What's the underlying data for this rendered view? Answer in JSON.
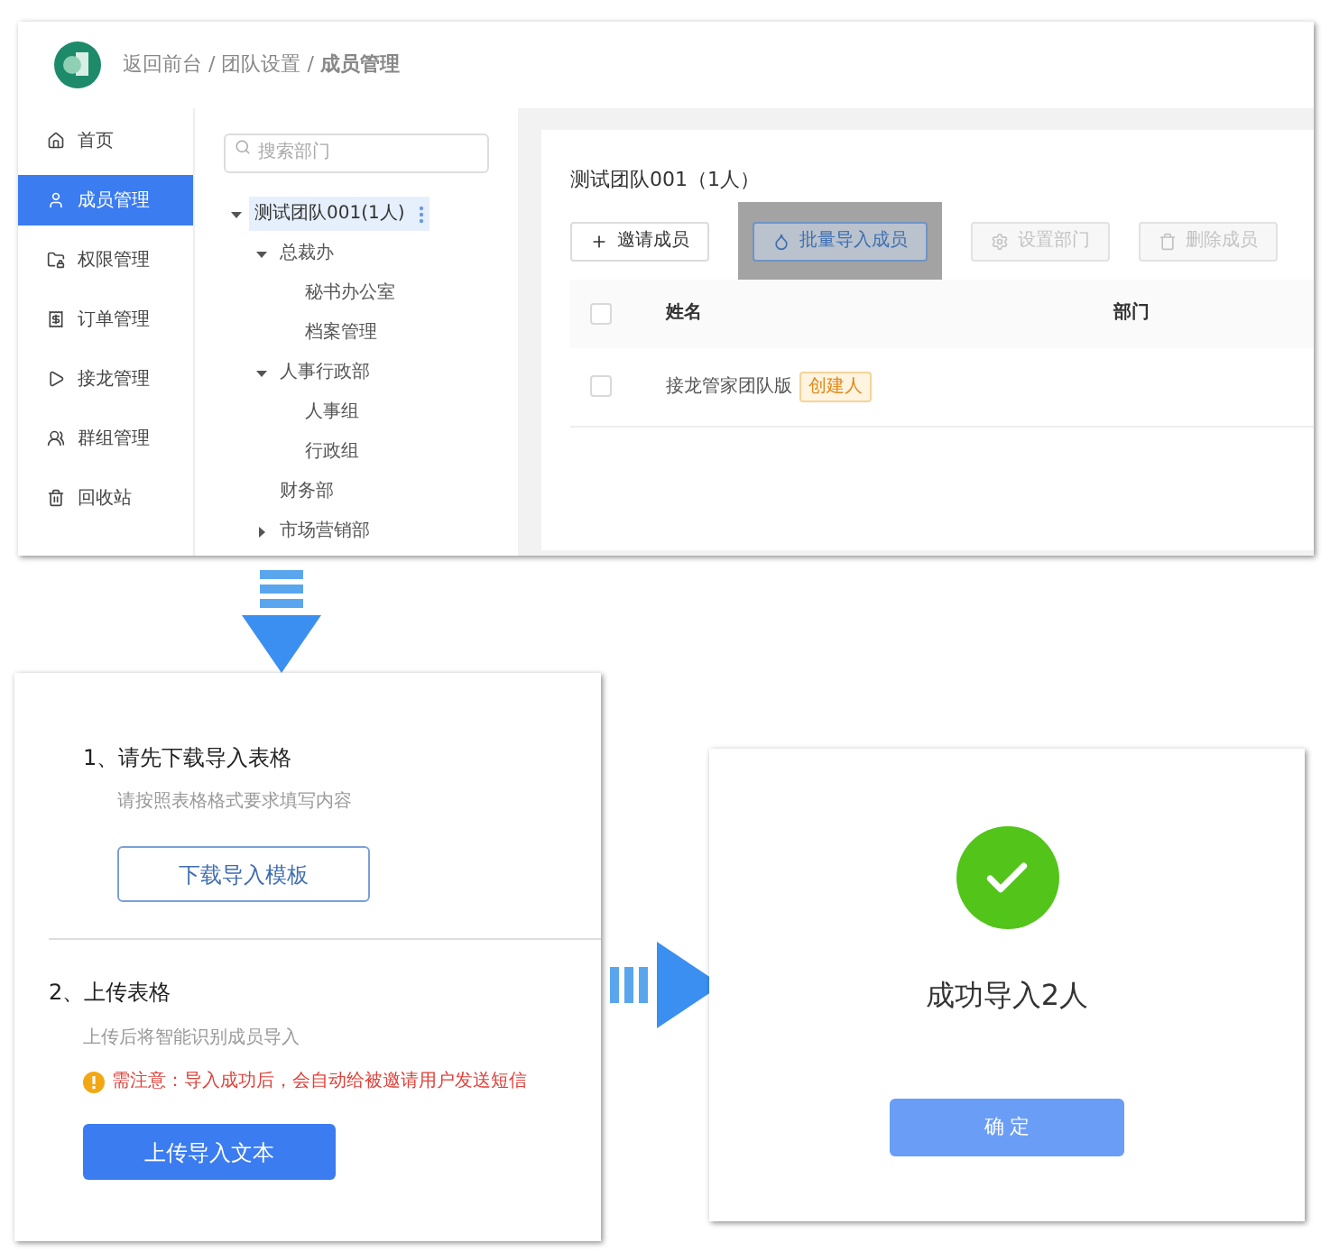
{
  "header": {
    "breadcrumb": "返回前台 / 团队设置 / **成员管理**"
  },
  "sidebar": {
    "items": [
      {
        "label": "首页",
        "selected": false
      },
      {
        "label": "成员管理",
        "selected": true
      },
      {
        "label": "权限管理",
        "selected": false
      },
      {
        "label": "订单管理",
        "selected": false
      },
      {
        "label": "接龙管理",
        "selected": false
      },
      {
        "label": "群组管理",
        "selected": false
      },
      {
        "label": "回收站",
        "selected": false
      }
    ]
  },
  "tree": {
    "search": {
      "placeholder": "搜索部门"
    },
    "nodes": [
      {
        "label": "测试团队001(1人)",
        "selected": true,
        "expanded": true,
        "children": [
          {
            "label": "总裁办",
            "selected": false,
            "expanded": true,
            "children": [
              {
                "label": "秘书办公室",
                "selected": false
              },
              {
                "label": "档案管理",
                "selected": false
              }
            ]
          },
          {
            "label": "人事行政部",
            "selected": false,
            "expanded": true,
            "children": [
              {
                "label": "人事组",
                "selected": false
              },
              {
                "label": "行政组",
                "selected": false
              }
            ]
          },
          {
            "label": "财务部",
            "selected": false
          },
          {
            "label": "市场营销部",
            "selected": false,
            "expanded": false
          }
        ]
      }
    ]
  },
  "content": {
    "title": "测试团队001（1人）",
    "toolbar": [
      {
        "label": "邀请成员",
        "disabled": false,
        "highlighted": false
      },
      {
        "label": "批量导入成员",
        "disabled": false,
        "highlighted": true
      },
      {
        "label": "设置部门",
        "disabled": true,
        "highlighted": false
      },
      {
        "label": "删除成员",
        "disabled": true,
        "highlighted": false
      }
    ],
    "table": {
      "header_checked": false,
      "columns": [
        "姓名",
        "部门"
      ],
      "rows": [
        {
          "checked": false,
          "name": "接龙管家团队版",
          "badge": "创建人"
        }
      ]
    }
  },
  "import_dialog": {
    "step1": {
      "title": "1、请先下载导入表格",
      "hint": "请按照表格格式要求填写内容",
      "button": "下载导入模板"
    },
    "step2": {
      "title": "2、上传表格",
      "hint": "上传后将智能识别成员导入",
      "warning": "需注意：导入成功后，会自动给被邀请用户发送短信",
      "button": "上传导入文本"
    }
  },
  "success_dialog": {
    "message": "成功导入2人",
    "button": "确 定"
  }
}
